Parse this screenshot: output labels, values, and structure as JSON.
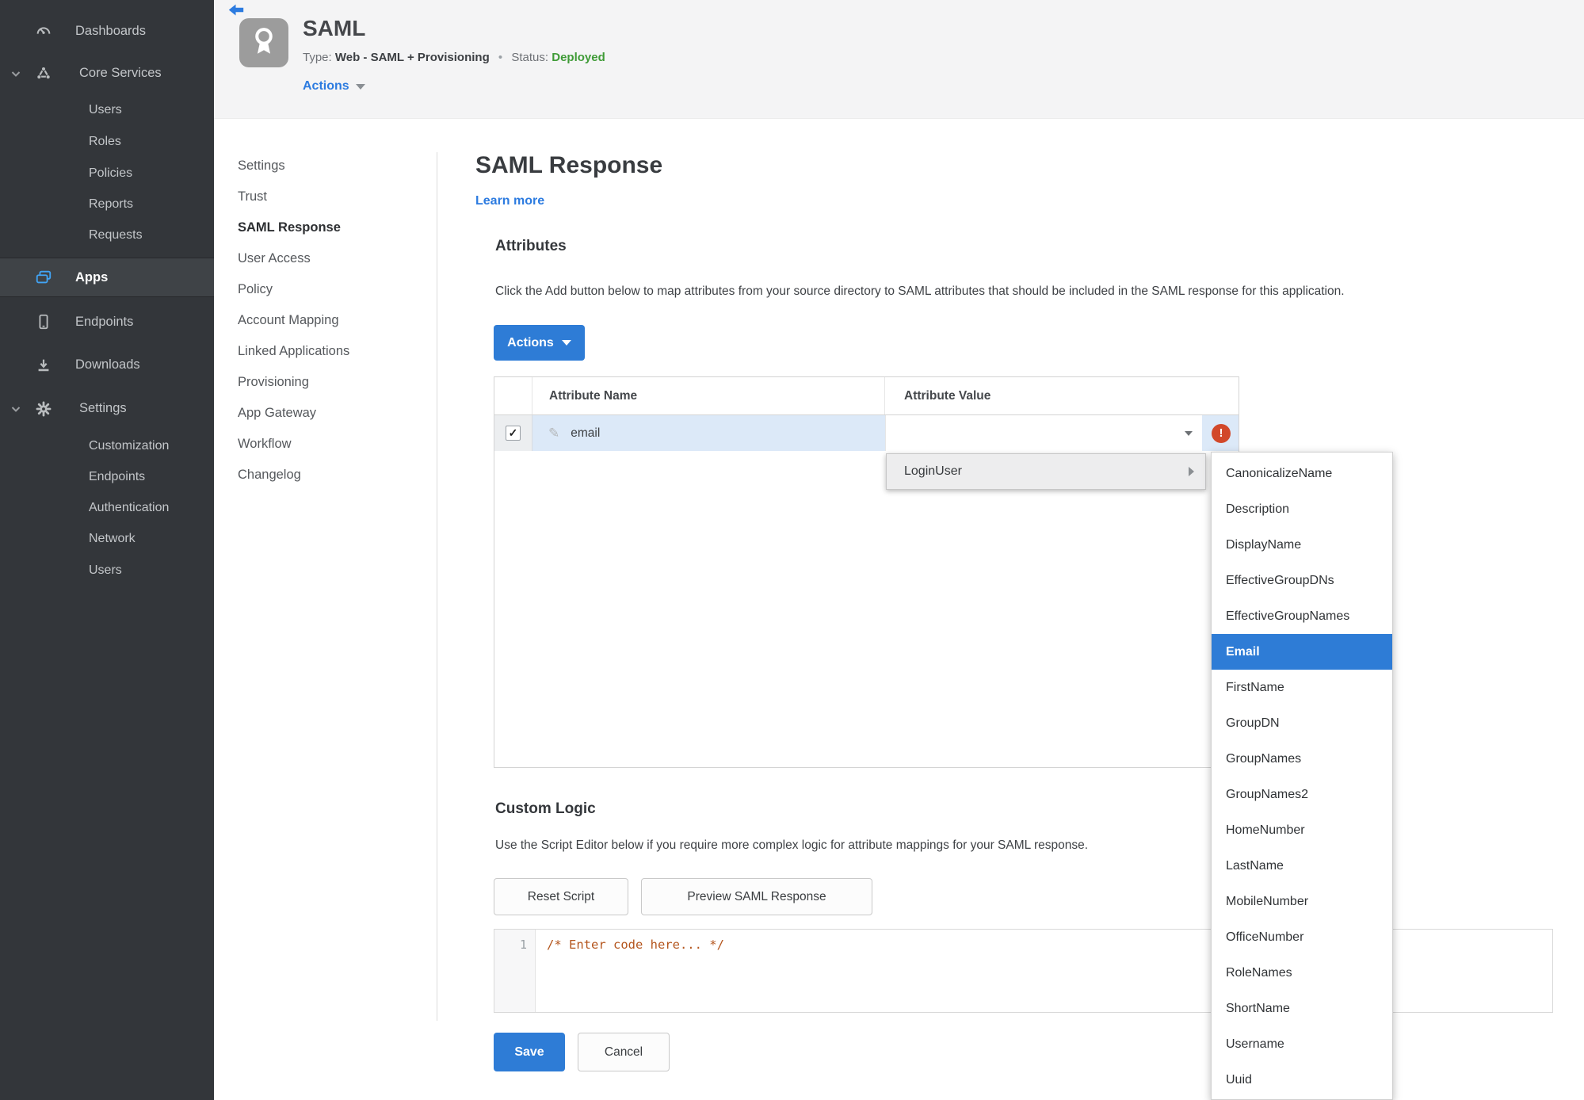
{
  "colors": {
    "accent_blue": "#2e7cd6",
    "link_blue": "#2c7be0",
    "status_green": "#3f9b37",
    "error_red": "#d2482a",
    "sidebar_bg": "#33363a",
    "selected_row_blue": "#dce9f8"
  },
  "icons": {
    "check": "✓",
    "pencil": "✎",
    "error": "!"
  },
  "sidebar": {
    "items": [
      {
        "label": "Dashboards",
        "icon": "gauge"
      },
      {
        "label": "Core Services",
        "icon": "core-services",
        "expanded": true
      },
      {
        "label": "Users"
      },
      {
        "label": "Roles"
      },
      {
        "label": "Policies"
      },
      {
        "label": "Reports"
      },
      {
        "label": "Requests"
      },
      {
        "label": "Apps",
        "icon": "apps",
        "selected": true
      },
      {
        "label": "Endpoints",
        "icon": "endpoint"
      },
      {
        "label": "Downloads",
        "icon": "download"
      },
      {
        "label": "Settings",
        "icon": "gear",
        "expanded": true
      },
      {
        "label": "Customization"
      },
      {
        "label": "Endpoints"
      },
      {
        "label": "Authentication"
      },
      {
        "label": "Network"
      },
      {
        "label": "Users"
      }
    ]
  },
  "header": {
    "title": "SAML",
    "type_label": "Type:",
    "type_value": "Web - SAML + Provisioning",
    "separator": "•",
    "status_label": "Status:",
    "status_value": "Deployed",
    "actions_label": "Actions"
  },
  "subnav": {
    "items": [
      "Settings",
      "Trust",
      "SAML Response",
      "User Access",
      "Policy",
      "Account Mapping",
      "Linked Applications",
      "Provisioning",
      "App Gateway",
      "Workflow",
      "Changelog"
    ],
    "active": "SAML Response"
  },
  "main": {
    "title": "SAML Response",
    "learn_more": "Learn more",
    "attributes": {
      "heading": "Attributes",
      "description": "Click the Add button below to map attributes from your source directory to SAML attributes that should be included in the SAML response for this application.",
      "actions_button": "Actions",
      "table": {
        "columns": [
          "Attribute Name",
          "Attribute Value"
        ],
        "rows": [
          {
            "checked": true,
            "name": "email",
            "value": ""
          }
        ]
      }
    },
    "value_menu": {
      "item": "LoginUser",
      "submenu": [
        "CanonicalizeName",
        "Description",
        "DisplayName",
        "EffectiveGroupDNs",
        "EffectiveGroupNames",
        "Email",
        "FirstName",
        "GroupDN",
        "GroupNames",
        "GroupNames2",
        "HomeNumber",
        "LastName",
        "MobileNumber",
        "OfficeNumber",
        "RoleNames",
        "ShortName",
        "Username",
        "Uuid"
      ],
      "selected": "Email"
    },
    "custom_logic": {
      "heading": "Custom Logic",
      "description": "Use the Script Editor below if you require more complex logic for attribute mappings for your SAML response.",
      "reset_button": "Reset Script",
      "preview_button": "Preview SAML Response",
      "editor": {
        "line_number": "1",
        "code": "/* Enter code here... */"
      }
    },
    "save_button": "Save",
    "cancel_button": "Cancel"
  }
}
